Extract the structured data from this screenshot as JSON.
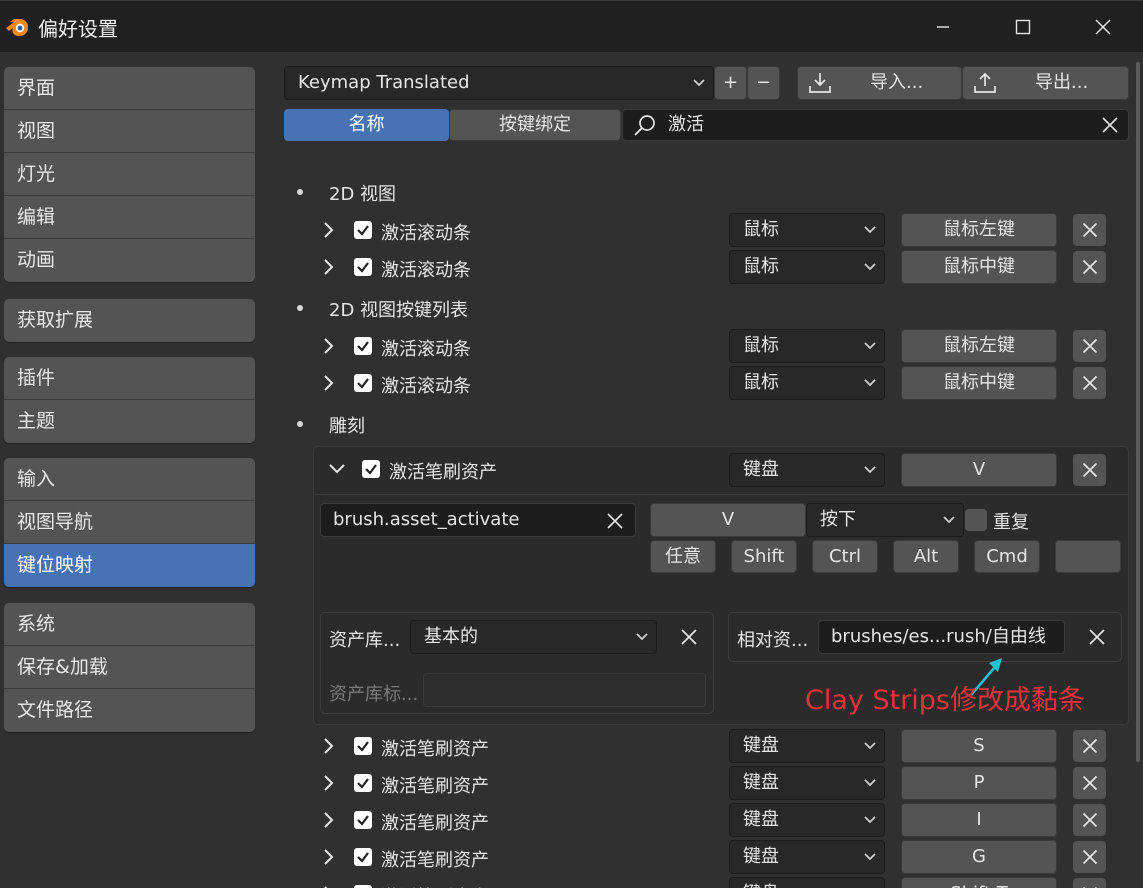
{
  "window": {
    "title": "偏好设置",
    "minimize_icon": "minimize-icon",
    "maximize_icon": "maximize-icon",
    "close_icon": "close-icon"
  },
  "sidebar": {
    "groups": [
      [
        "界面",
        "视图",
        "灯光",
        "编辑",
        "动画"
      ],
      [
        "获取扩展"
      ],
      [
        "插件",
        "主题"
      ],
      [
        "输入",
        "视图导航",
        "键位映射"
      ],
      [
        "系统",
        "保存&加载",
        "文件路径"
      ]
    ],
    "active": "键位映射"
  },
  "toolbar": {
    "preset": "Keymap Translated",
    "add_label": "+",
    "remove_label": "−",
    "import_label": "导入...",
    "export_label": "导出...",
    "tab_name": "名称",
    "tab_binding": "按键绑定",
    "search_value": "激活"
  },
  "categories": [
    {
      "title": "2D 视图",
      "rows": [
        {
          "label": "激活滚动条",
          "device": "鼠标",
          "key": "鼠标左键"
        },
        {
          "label": "激活滚动条",
          "device": "鼠标",
          "key": "鼠标中键"
        }
      ]
    },
    {
      "title": "2D 视图按键列表",
      "rows": [
        {
          "label": "激活滚动条",
          "device": "鼠标",
          "key": "鼠标左键"
        },
        {
          "label": "激活滚动条",
          "device": "鼠标",
          "key": "鼠标中键"
        }
      ]
    },
    {
      "title": "雕刻",
      "rows": []
    }
  ],
  "expanded": {
    "label": "激活笔刷资产",
    "device": "键盘",
    "key": "V",
    "operator": "brush.asset_activate",
    "key_value": "V",
    "event": "按下",
    "repeat_label": "重复",
    "modifiers": [
      "任意",
      "Shift",
      "Ctrl",
      "Alt",
      "Cmd"
    ],
    "asset_lib_label": "资产库...",
    "asset_lib_value": "基本的",
    "relative_label": "相对资...",
    "relative_value": "brushes/es...rush/自由线",
    "asset_lib_id_label": "资产库标..."
  },
  "annotation": "Clay Strips修改成黏条",
  "more_rows": [
    {
      "label": "激活笔刷资产",
      "device": "键盘",
      "key": "S"
    },
    {
      "label": "激活笔刷资产",
      "device": "键盘",
      "key": "P"
    },
    {
      "label": "激活笔刷资产",
      "device": "键盘",
      "key": "I"
    },
    {
      "label": "激活笔刷资产",
      "device": "键盘",
      "key": "G"
    },
    {
      "label": "激活笔刷资产",
      "device": "键盘",
      "key": "Shift T"
    }
  ],
  "colors": {
    "accent": "#4772b3",
    "annotation": "#e8323a",
    "arrow": "#22c3d6"
  }
}
